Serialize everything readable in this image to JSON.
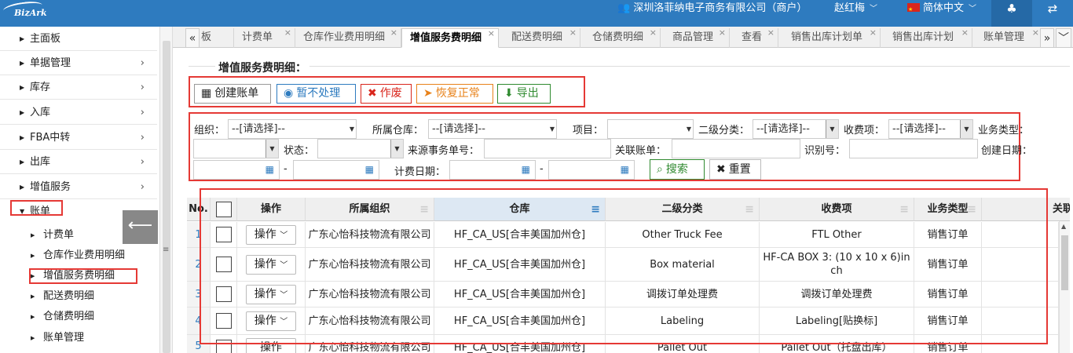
{
  "app": {
    "logo_text": "BizArk"
  },
  "topbar": {
    "company": "深圳洛菲纳电子商务有限公司（商户）",
    "user": "赵红梅",
    "language": "简体中文",
    "tree_icon": "tree-icon",
    "switch_icon": "swap-icon"
  },
  "sidebar": {
    "items": [
      {
        "label": "主面板"
      },
      {
        "label": "单据管理"
      },
      {
        "label": "库存"
      },
      {
        "label": "入库"
      },
      {
        "label": "FBA中转"
      },
      {
        "label": "出库"
      },
      {
        "label": "增值服务"
      },
      {
        "label": "账单"
      }
    ],
    "subitems": [
      {
        "label": "计费单"
      },
      {
        "label": "仓库作业费用明细"
      },
      {
        "label": "增值服务费明细"
      },
      {
        "label": "配送费明细"
      },
      {
        "label": "仓储费明细"
      },
      {
        "label": "账单管理"
      }
    ]
  },
  "tabs": [
    {
      "label": "板"
    },
    {
      "label": "计费单"
    },
    {
      "label": "仓库作业费用明细"
    },
    {
      "label": "增值服务费明细"
    },
    {
      "label": "配送费明细"
    },
    {
      "label": "仓储费明细"
    },
    {
      "label": "商品管理"
    },
    {
      "label": "查看"
    },
    {
      "label": "销售出库计划单"
    },
    {
      "label": "销售出库计划"
    },
    {
      "label": "账单管理"
    }
  ],
  "panel": {
    "title": "增值服务费明细："
  },
  "toolbar": {
    "create_bill": "创建账单",
    "hold": "暂不处理",
    "void": "作废",
    "restore": "恢复正常",
    "export": "导出"
  },
  "filters": {
    "org_label": "组织：",
    "org_value": "--[请选择]--",
    "warehouse_label": "所属仓库：",
    "warehouse_value": "--[请选择]--",
    "item_label": "项目：",
    "sub_label": "二级分类：",
    "sub_value": "--[请选择]--",
    "fee_label": "收费项：",
    "fee_value": "--[请选择]--",
    "biz_label": "业务类型：",
    "status_label": "状态：",
    "source_label": "来源事务单号：",
    "bill_label": "关联账单：",
    "id_label": "识别号：",
    "created_label": "创建日期：",
    "dash": "-",
    "billing_label": "计费日期：",
    "search": "搜索",
    "reset": "重置"
  },
  "grid": {
    "headers": [
      "No.",
      "",
      "操作",
      "所属组织",
      "仓库",
      "二级分类",
      "收费项",
      "业务类型",
      "关联账"
    ],
    "op_label": "操作",
    "rows": [
      {
        "no": "1",
        "org": "广东心怡科技物流有限公司",
        "wh": "HF_CA_US[合丰美国加州仓]",
        "sub": "Other Truck Fee",
        "fee": "FTL Other",
        "biz": "销售订单"
      },
      {
        "no": "2",
        "org": "广东心怡科技物流有限公司",
        "wh": "HF_CA_US[合丰美国加州仓]",
        "sub": "Box material",
        "fee": "HF-CA BOX 3: (10 x 10 x 6)inch",
        "biz": "销售订单"
      },
      {
        "no": "3",
        "org": "广东心怡科技物流有限公司",
        "wh": "HF_CA_US[合丰美国加州仓]",
        "sub": "调拨订单处理费",
        "fee": "调拨订单处理费",
        "biz": "销售订单"
      },
      {
        "no": "4",
        "org": "广东心怡科技物流有限公司",
        "wh": "HF_CA_US[合丰美国加州仓]",
        "sub": "Labeling",
        "fee": "Labeling[贴换标]",
        "biz": "销售订单"
      },
      {
        "no": "5",
        "org": "广东心怡科技物流有限公司",
        "wh": "HF_CA_US[合丰美国加州仓]",
        "sub": "Pallet Out",
        "fee": "Pallet Out（托盘出库）",
        "biz": "销售订单"
      }
    ]
  }
}
